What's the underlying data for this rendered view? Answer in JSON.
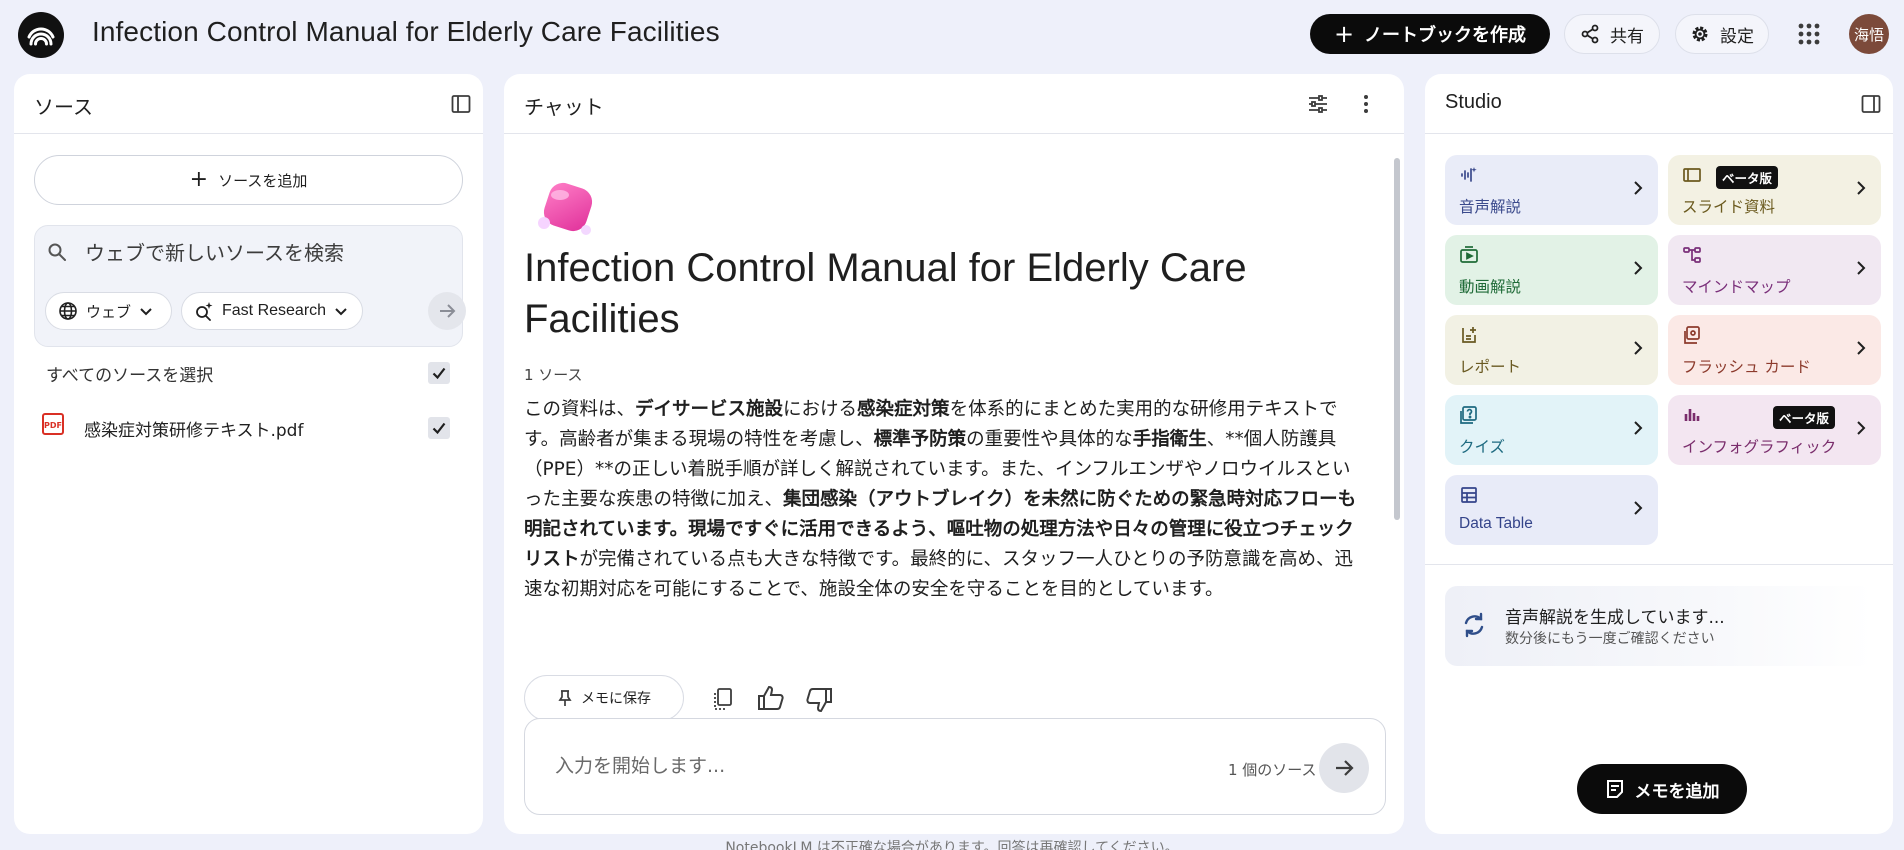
{
  "header": {
    "title": "Infection Control Manual for Elderly Care Facilities",
    "create_notebook_label": "ノートブックを作成",
    "share_label": "共有",
    "settings_label": "設定",
    "avatar_text": "海悟"
  },
  "sources": {
    "title": "ソース",
    "add_source_label": "ソースを追加",
    "search_placeholder": "ウェブで新しいソースを検索",
    "web_chip_label": "ウェブ",
    "research_chip_label": "Fast Research",
    "select_all_label": "すべてのソースを選択",
    "items": [
      {
        "name": "感染症対策研修テキスト.pdf",
        "icon": "pdf-icon",
        "checked": true
      }
    ]
  },
  "chat": {
    "title": "チャット",
    "doc_title": "Infection Control Manual for Elderly Care Facilities",
    "source_count": "1 ソース",
    "summary_segments": [
      {
        "text": "この資料は、",
        "bold": false
      },
      {
        "text": "デイサービス施設",
        "bold": true
      },
      {
        "text": "における",
        "bold": false
      },
      {
        "text": "感染症対策",
        "bold": true
      },
      {
        "text": "を体系的にまとめた実用的な研修用テキストです。高齢者が集まる現場の特性を考慮し、",
        "bold": false
      },
      {
        "text": "標準予防策",
        "bold": true
      },
      {
        "text": "の重要性や具体的な",
        "bold": false
      },
      {
        "text": "手指衛生",
        "bold": true
      },
      {
        "text": "、**個人防護具（PPE）**の正しい着脱手順が詳しく解説されています。また、インフルエンザやノロウイルスといった主要な疾患の特徴に加え、",
        "bold": false
      },
      {
        "text": "集団感染（アウトブレイク）を未然に防ぐための緊急時対応フローも明記されています。現場ですぐに活用できるよう、嘔吐物の処理方法や日々の管理に役立つチェックリスト",
        "bold": true
      },
      {
        "text": "が完備されている点も大きな特徴です。最終的に、スタッフ一人ひとりの予防意識を高め、迅速な初期対応を可能にすることで、施設全体の安全を守ることを目的としています。",
        "bold": false
      }
    ],
    "save_memo_label": "メモに保存",
    "input_placeholder": "入力を開始します...",
    "input_source_count": "1 個のソース"
  },
  "studio": {
    "title": "Studio",
    "tiles": [
      {
        "label": "音声解説",
        "icon": "audio-waveform-icon",
        "bg": "#e9ecf8",
        "fg": "#3b4a8c"
      },
      {
        "label": "スライド資料",
        "icon": "slides-icon",
        "bg": "#f3f1e3",
        "fg": "#6b5a1e",
        "beta": "ベータ版"
      },
      {
        "label": "動画解説",
        "icon": "video-icon",
        "bg": "#e2f2e6",
        "fg": "#1f6b37"
      },
      {
        "label": "マインドマップ",
        "icon": "mindmap-icon",
        "bg": "#f1e8f2",
        "fg": "#7a2f7a"
      },
      {
        "label": "レポート",
        "icon": "report-icon",
        "bg": "#f2f1e4",
        "fg": "#6a5a22"
      },
      {
        "label": "フラッシュ カード",
        "icon": "flashcard-icon",
        "bg": "#fbe9e6",
        "fg": "#8c3a2c"
      },
      {
        "label": "クイズ",
        "icon": "quiz-icon",
        "bg": "#e2f3f8",
        "fg": "#1e6a80"
      },
      {
        "label": "インフォグラフィック",
        "icon": "infographic-icon",
        "bg": "#f3e6f1",
        "fg": "#7a2d6c",
        "beta": "ベータ版"
      },
      {
        "label": "Data Table",
        "icon": "table-icon",
        "bg": "#e8ebf8",
        "fg": "#34448a"
      }
    ],
    "generating_title": "音声解説を生成しています...",
    "generating_sub": "数分後にもう一度ご確認ください",
    "add_memo_label": "メモを追加"
  },
  "footer": {
    "disclaimer": "NotebookLM は不正確な場合があります。回答は再確認してください。"
  }
}
